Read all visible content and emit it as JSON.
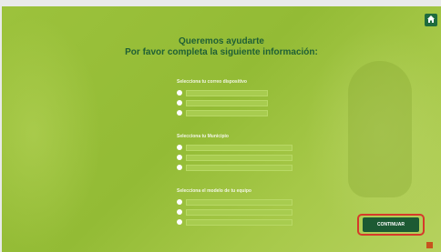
{
  "header": {
    "title_line1": "Queremos ayudarte",
    "title_line2": "Por favor completa la siguiente información:"
  },
  "sections": [
    {
      "label": "Selecciona tu correo dispositivo",
      "options": [
        "",
        "",
        ""
      ]
    },
    {
      "label": "Selecciona tu Municipio",
      "options": [
        "",
        "",
        ""
      ]
    },
    {
      "label": "Selecciona el modelo de tu equipo",
      "options": [
        "",
        "",
        ""
      ]
    }
  ],
  "actions": {
    "continue_label": "CONTINUAR"
  },
  "icons": {
    "home": "home-icon"
  },
  "colors": {
    "accent": "#1c5a33",
    "background": "#9cc23c",
    "highlight": "#d63a2a"
  }
}
